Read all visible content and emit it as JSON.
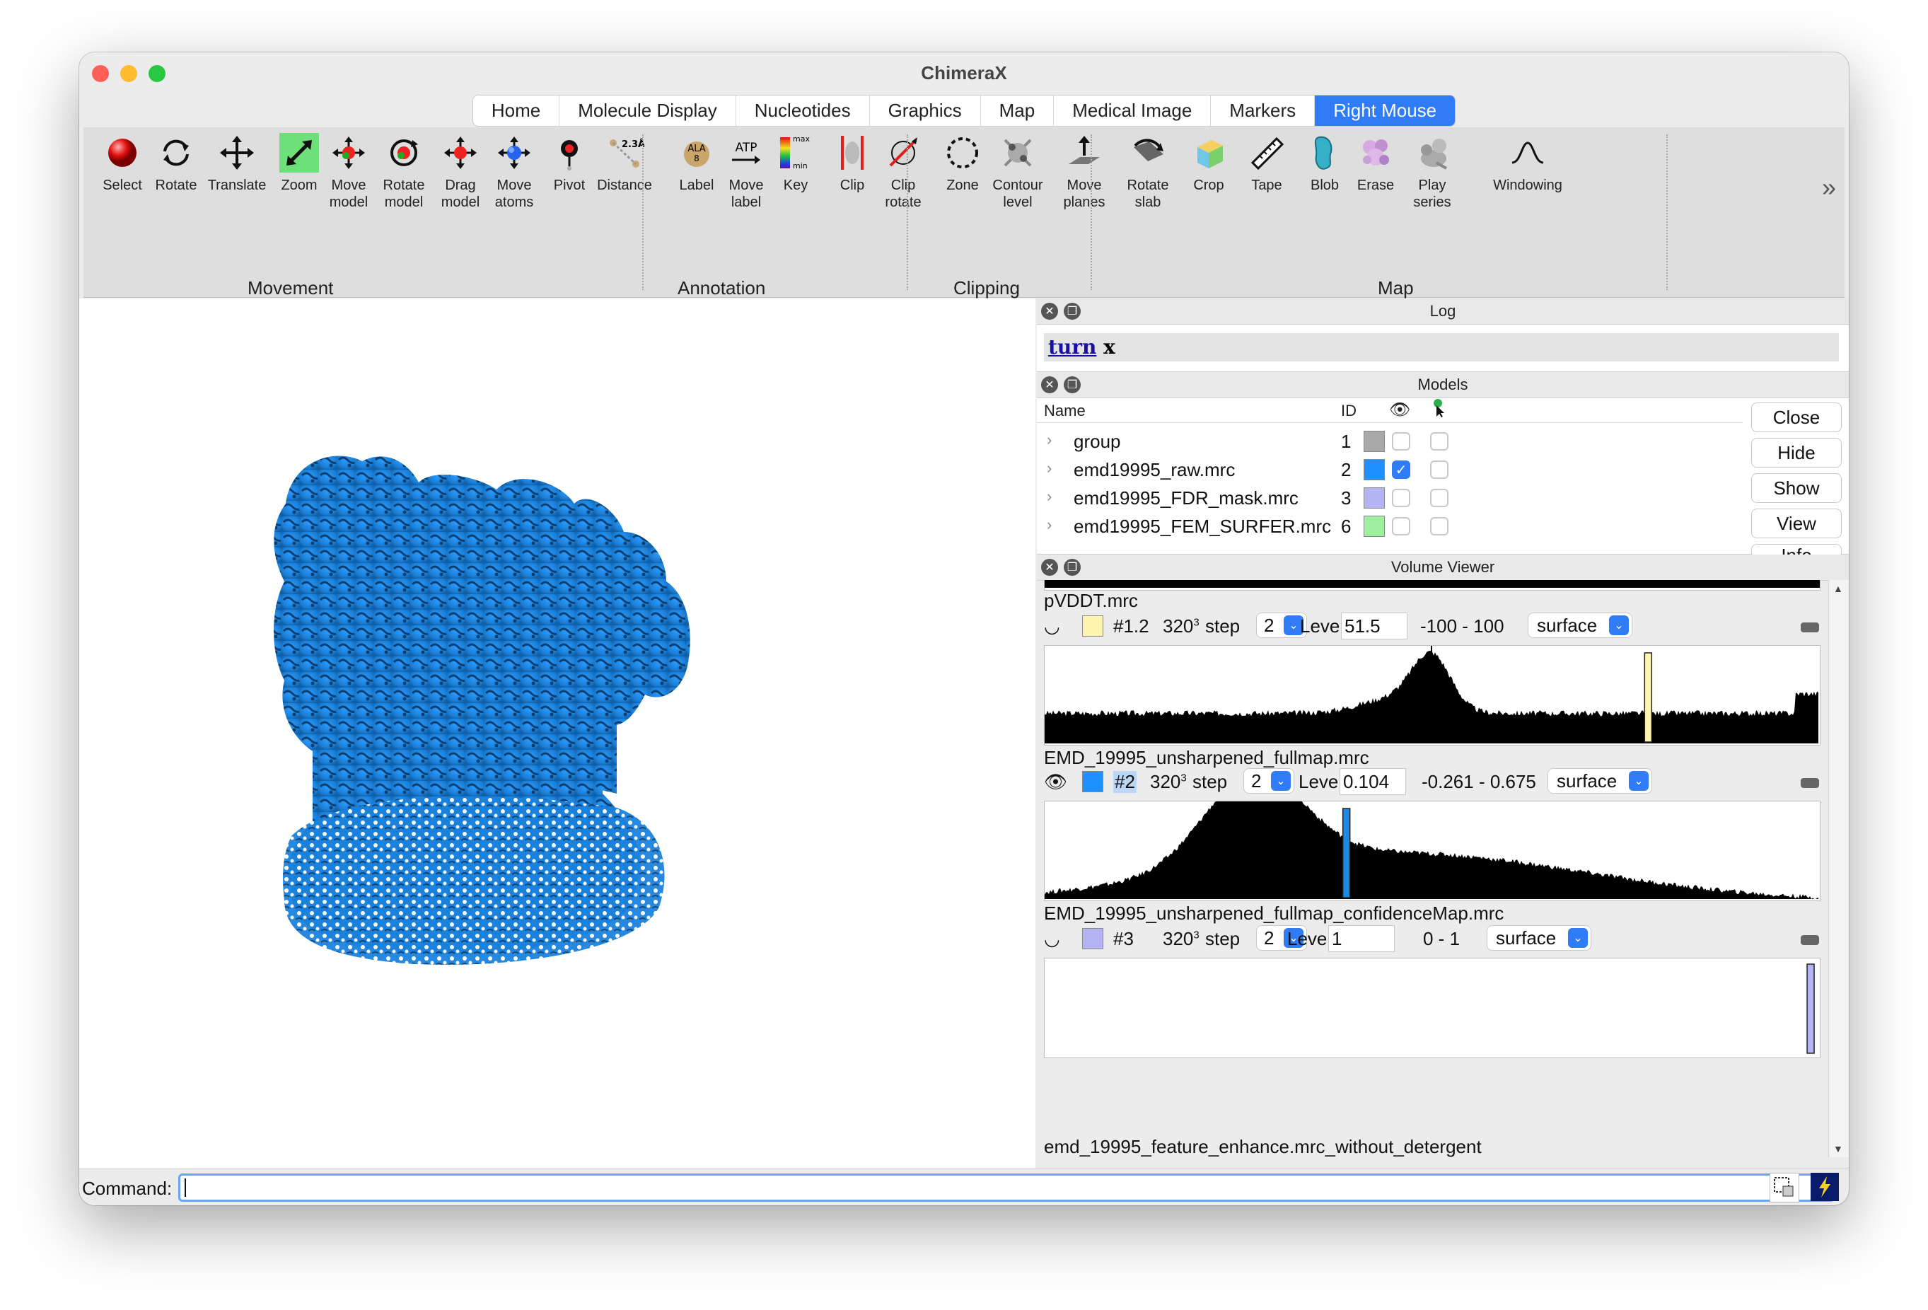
{
  "window": {
    "title": "ChimeraX"
  },
  "tabs": [
    "Home",
    "Molecule Display",
    "Nucleotides",
    "Graphics",
    "Map",
    "Medical Image",
    "Markers",
    "Right Mouse"
  ],
  "active_tab": "Right Mouse",
  "toolbar": {
    "groups": [
      "Movement",
      "Annotation",
      "Clipping",
      "Map"
    ],
    "movement": [
      {
        "label1": "Select",
        "label2": "",
        "icon": "red-sphere-icon"
      },
      {
        "label1": "Rotate",
        "label2": "",
        "icon": "rotate-arrows-icon"
      },
      {
        "label1": "Translate",
        "label2": "",
        "icon": "four-way-arrows-icon"
      },
      {
        "label1": "Zoom",
        "label2": "",
        "icon": "zoom-diagonal-icon"
      },
      {
        "label1": "Move",
        "label2": "model",
        "icon": "move-model-icon"
      },
      {
        "label1": "Rotate",
        "label2": "model",
        "icon": "rotate-model-icon"
      },
      {
        "label1": "Drag",
        "label2": "model",
        "icon": "drag-model-icon"
      },
      {
        "label1": "Move",
        "label2": "atoms",
        "icon": "move-atoms-icon"
      },
      {
        "label1": "Pivot",
        "label2": "",
        "icon": "pivot-icon"
      }
    ],
    "annotation": [
      {
        "label1": "Distance",
        "label2": "",
        "icon": "distance-icon",
        "text": "2.3Å"
      },
      {
        "label1": "Label",
        "label2": "",
        "icon": "label-icon",
        "text": "ALA 8"
      },
      {
        "label1": "Move",
        "label2": "label",
        "icon": "move-label-icon",
        "text": "ATP"
      },
      {
        "label1": "Key",
        "label2": "",
        "icon": "color-key-icon",
        "text_max": "max",
        "text_min": "min"
      }
    ],
    "clipping": [
      {
        "label1": "Clip",
        "label2": "",
        "icon": "clip-icon"
      },
      {
        "label1": "Clip",
        "label2": "rotate",
        "icon": "clip-rotate-icon"
      },
      {
        "label1": "Zone",
        "label2": "",
        "icon": "zone-icon"
      }
    ],
    "map": [
      {
        "label1": "Contour",
        "label2": "level",
        "icon": "contour-level-icon"
      },
      {
        "label1": "Move",
        "label2": "planes",
        "icon": "move-planes-icon"
      },
      {
        "label1": "Rotate",
        "label2": "slab",
        "icon": "rotate-slab-icon"
      },
      {
        "label1": "Crop",
        "label2": "",
        "icon": "crop-icon"
      },
      {
        "label1": "Tape",
        "label2": "",
        "icon": "tape-measure-icon"
      },
      {
        "label1": "Blob",
        "label2": "",
        "icon": "blob-icon"
      },
      {
        "label1": "Erase",
        "label2": "",
        "icon": "erase-icon"
      },
      {
        "label1": "Play",
        "label2": "series",
        "icon": "play-series-icon"
      },
      {
        "label1": "Windowing",
        "label2": "",
        "icon": "windowing-icon"
      }
    ],
    "more": "»"
  },
  "log": {
    "title": "Log",
    "link": "turn",
    "rest": " x"
  },
  "models": {
    "title": "Models",
    "columns": {
      "name": "Name",
      "id": "ID"
    },
    "rows": [
      {
        "name": "group",
        "id": "1",
        "color": "#a9a9a9",
        "shown": false
      },
      {
        "name": "emd19995_raw.mrc",
        "id": "2",
        "color": "#1e90ff",
        "shown": true
      },
      {
        "name": "emd19995_FDR_mask.mrc",
        "id": "3",
        "color": "#b4b4f5",
        "shown": false
      },
      {
        "name": "emd19995_FEM_SURFER.mrc",
        "id": "6",
        "color": "#9ef09e",
        "shown": false
      }
    ],
    "buttons": [
      "Close",
      "Hide",
      "Show",
      "View",
      "Info"
    ]
  },
  "volume_viewer": {
    "title": "Volume Viewer",
    "maps": [
      {
        "file": "pVDDT.mrc",
        "color": "#fff4b0",
        "id": "#1.2",
        "size": "320",
        "step": "2",
        "level": "51.5",
        "range": "-100 - 100",
        "style": "surface",
        "visible": false,
        "marker_color": "#fff4b0",
        "marker_pos": 0.78
      },
      {
        "file": "EMD_19995_unsharpened_fullmap.mrc",
        "color": "#1e90ff",
        "id": "#2",
        "size": "320",
        "step": "2",
        "level": "0.104",
        "range": "-0.261 - 0.675",
        "style": "surface",
        "visible": true,
        "marker_color": "#1e88e5",
        "marker_pos": 0.39
      },
      {
        "file": "EMD_19995_unsharpened_fullmap_confidenceMap.mrc",
        "color": "#b4b4f5",
        "id": "#3",
        "size": "320",
        "step": "2",
        "level": "1",
        "range": "0 - 1",
        "style": "surface",
        "visible": false,
        "marker_color": "#b4b4f5",
        "marker_pos": 0.99
      }
    ],
    "next_file": "emd_19995_feature_enhance.mrc_without_detergent",
    "labels": {
      "step": "step",
      "level": "Level"
    }
  },
  "command": {
    "label": "Command:",
    "value": ""
  },
  "colors": {
    "accent": "#2f7cf6",
    "density": "#1e88e5"
  }
}
